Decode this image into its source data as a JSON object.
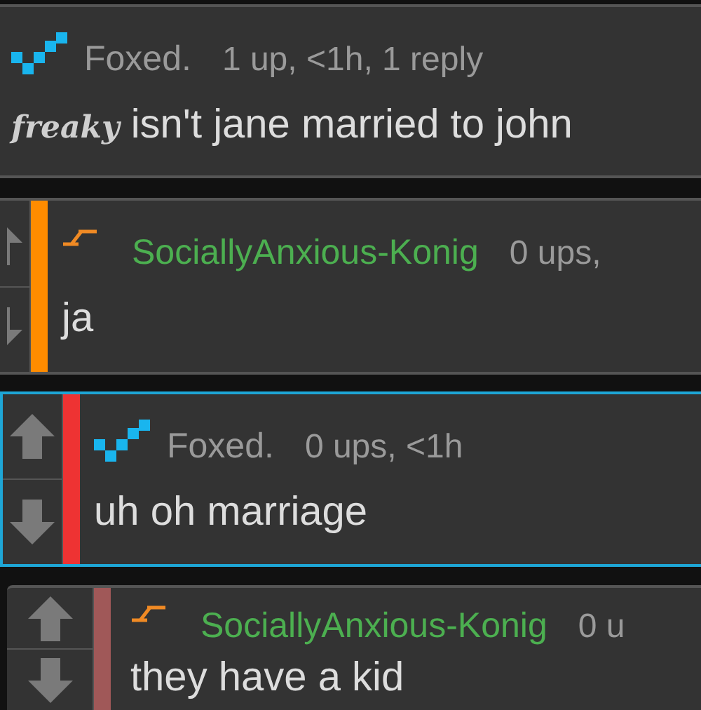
{
  "comments": [
    {
      "author": "Foxed.",
      "kind": "check",
      "meta": "1 up, <1h, 1 reply",
      "flair": "freaky",
      "body": "isn't jane married to john",
      "votes": false,
      "highlighted": false
    },
    {
      "author": "SociallyAnxious-Konig",
      "kind": "bolt",
      "meta": "0 ups,",
      "body": "ja",
      "votes": true,
      "color": "#ff8c00",
      "highlighted": false
    },
    {
      "author": "Foxed.",
      "kind": "check",
      "meta": "0 ups, <1h",
      "body": "uh oh marriage",
      "votes": true,
      "color": "#ee3333",
      "highlighted": true
    },
    {
      "author": "SociallyAnxious-Konig",
      "kind": "bolt",
      "meta": "0 u",
      "body": "they have a kid",
      "votes": true,
      "color": "#a05858",
      "highlighted": false
    }
  ]
}
